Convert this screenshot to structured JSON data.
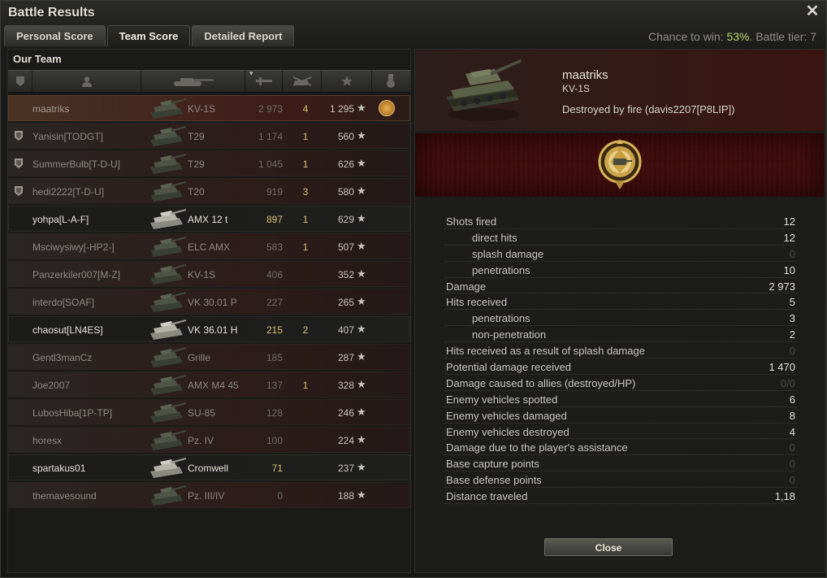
{
  "window": {
    "title": "Battle Results",
    "close_glyph": "✕"
  },
  "tabs": [
    {
      "label": "Personal Score",
      "active": false
    },
    {
      "label": "Team Score",
      "active": true
    },
    {
      "label": "Detailed Report",
      "active": false
    }
  ],
  "chance": {
    "prefix": "Chance to win: ",
    "value": "53%",
    "suffix": ". Battle tier: 7"
  },
  "team": {
    "label": "Our Team",
    "columns": [
      "squad-icon",
      "player-icon",
      "vehicle-icon",
      "damage-icon",
      "kills-icon",
      "xp-star-icon",
      "medal-icon"
    ],
    "rows": [
      {
        "name": "maatriks",
        "vehicle": "KV-1S",
        "damage": "2 973",
        "kills": "4",
        "xp": "1 295",
        "state": "self",
        "squad": false,
        "medal": true
      },
      {
        "name": "Yanisin[TODGT]",
        "vehicle": "T29",
        "damage": "1 174",
        "kills": "1",
        "xp": "560",
        "state": "dead",
        "squad": true
      },
      {
        "name": "SummerBulb[T-D-U]",
        "vehicle": "T29",
        "damage": "1 045",
        "kills": "1",
        "xp": "626",
        "state": "dead",
        "squad": true
      },
      {
        "name": "hedi2222[T-D-U]",
        "vehicle": "T20",
        "damage": "919",
        "kills": "3",
        "xp": "580",
        "state": "dead",
        "squad": true
      },
      {
        "name": "yohpa[L-A-F]",
        "vehicle": "AMX 12 t",
        "damage": "897",
        "kills": "1",
        "xp": "629",
        "state": "alive",
        "squad": false
      },
      {
        "name": "Msciwysiwy[-HP2-]",
        "vehicle": "ELC AMX",
        "damage": "583",
        "kills": "1",
        "xp": "507",
        "state": "dead",
        "squad": false
      },
      {
        "name": "Panzerkiler007[M-Z]",
        "vehicle": "KV-1S",
        "damage": "406",
        "kills": "",
        "xp": "352",
        "state": "dead",
        "squad": false
      },
      {
        "name": "interdo[SOAF]",
        "vehicle": "VK 30.01 P",
        "damage": "227",
        "kills": "",
        "xp": "265",
        "state": "dead",
        "squad": false
      },
      {
        "name": "chaosut[LN4ES]",
        "vehicle": "VK 36.01 H",
        "damage": "215",
        "kills": "2",
        "xp": "407",
        "state": "alive",
        "squad": false
      },
      {
        "name": "Gentl3manCz",
        "vehicle": "Grille",
        "damage": "185",
        "kills": "",
        "xp": "287",
        "state": "dead",
        "squad": false
      },
      {
        "name": "Joe2007",
        "vehicle": "AMX M4 45",
        "damage": "137",
        "kills": "1",
        "xp": "328",
        "state": "dead",
        "squad": false
      },
      {
        "name": "LubosHiba[1P-TP]",
        "vehicle": "SU-85",
        "damage": "128",
        "kills": "",
        "xp": "246",
        "state": "dead",
        "squad": false
      },
      {
        "name": "horesx",
        "vehicle": "Pz. IV",
        "damage": "100",
        "kills": "",
        "xp": "224",
        "state": "dead",
        "squad": false
      },
      {
        "name": "spartakus01",
        "vehicle": "Cromwell",
        "damage": "71",
        "kills": "",
        "xp": "237",
        "state": "alive",
        "squad": false
      },
      {
        "name": "themavesound",
        "vehicle": "Pz. III/IV",
        "damage": "0",
        "kills": "",
        "xp": "188",
        "state": "dead",
        "squad": false
      }
    ]
  },
  "detail": {
    "player": "maatriks",
    "tank": "KV-1S",
    "death": "Destroyed by fire (davis2207[P8LIP])",
    "stats": [
      {
        "label": "Shots fired",
        "value": "12",
        "sub": false,
        "dim": false
      },
      {
        "label": "direct hits",
        "value": "12",
        "sub": true,
        "dim": false
      },
      {
        "label": "splash damage",
        "value": "0",
        "sub": true,
        "dim": true
      },
      {
        "label": "penetrations",
        "value": "10",
        "sub": true,
        "dim": false
      },
      {
        "label": "Damage",
        "value": "2 973",
        "sub": false,
        "dim": false
      },
      {
        "label": "Hits received",
        "value": "5",
        "sub": false,
        "dim": false
      },
      {
        "label": "penetrations",
        "value": "3",
        "sub": true,
        "dim": false
      },
      {
        "label": "non-penetration",
        "value": "2",
        "sub": true,
        "dim": false
      },
      {
        "label": "Hits received as a result of splash damage",
        "value": "0",
        "sub": false,
        "dim": true
      },
      {
        "label": "Potential damage received",
        "value": "1 470",
        "sub": false,
        "dim": false
      },
      {
        "label": "Damage caused to allies (destroyed/HP)",
        "value": "0/0",
        "sub": false,
        "dim": true
      },
      {
        "label": "Enemy vehicles spotted",
        "value": "6",
        "sub": false,
        "dim": false
      },
      {
        "label": "Enemy vehicles damaged",
        "value": "8",
        "sub": false,
        "dim": false
      },
      {
        "label": "Enemy vehicles destroyed",
        "value": "4",
        "sub": false,
        "dim": false
      },
      {
        "label": "Damage due to the player's assistance",
        "value": "0",
        "sub": false,
        "dim": true
      },
      {
        "label": "Base capture points",
        "value": "0",
        "sub": false,
        "dim": true
      },
      {
        "label": "Base defense points",
        "value": "0",
        "sub": false,
        "dim": true
      },
      {
        "label": "Distance traveled",
        "value": "1,18",
        "sub": false,
        "dim": false
      }
    ],
    "close_label": "Close"
  }
}
